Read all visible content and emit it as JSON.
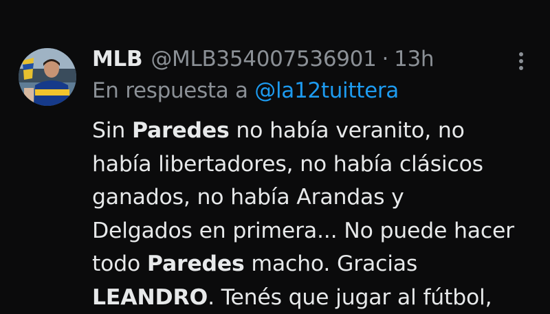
{
  "tweet": {
    "author": {
      "display_name": "MLB",
      "handle": "@MLB354007536901"
    },
    "separator": "·",
    "time": "13h",
    "reply": {
      "prefix": "En respuesta a",
      "mention": "@la12tuittera"
    },
    "body": {
      "line1": {
        "pre": "Sin ",
        "bold": "Paredes",
        "post": " no había veranito, no"
      },
      "line2": "había libertadores, no había clásicos",
      "line3": "ganados, no había Arandas y",
      "line4": "Delgados en primera... No puede hacer",
      "line5": {
        "pre": "todo ",
        "bold": "Paredes",
        "post": " macho. Gracias"
      },
      "line6": {
        "bold": "LEANDRO",
        "post": ". Tenés que jugar al fútbol,"
      }
    },
    "more_icon": "more-vertical-icon",
    "colors": {
      "background": "#0b0b0c",
      "text": "#e7e9ea",
      "secondary": "#8b9096",
      "link": "#1d9bf0"
    }
  }
}
